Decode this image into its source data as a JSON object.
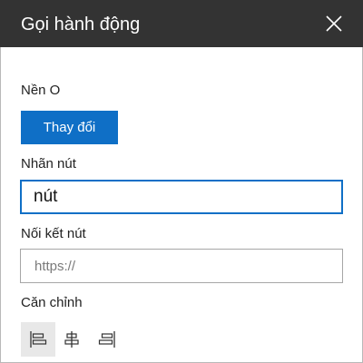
{
  "panel": {
    "title": "Gọi hành động",
    "close_icon": "close-icon"
  },
  "background": {
    "label": "Nền O",
    "change_button": "Thay đổi"
  },
  "button_label": {
    "label": "Nhãn nút",
    "value": "nút"
  },
  "button_link": {
    "label": "Nối kết nút",
    "placeholder": "https://",
    "value": ""
  },
  "alignment": {
    "label": "Căn chỉnh",
    "options": [
      {
        "name": "align-left-icon",
        "selected": true
      },
      {
        "name": "align-center-icon",
        "selected": false
      },
      {
        "name": "align-right-icon",
        "selected": false
      }
    ]
  },
  "colors": {
    "header_bg": "#333333",
    "accent": "#0f6fc6"
  }
}
